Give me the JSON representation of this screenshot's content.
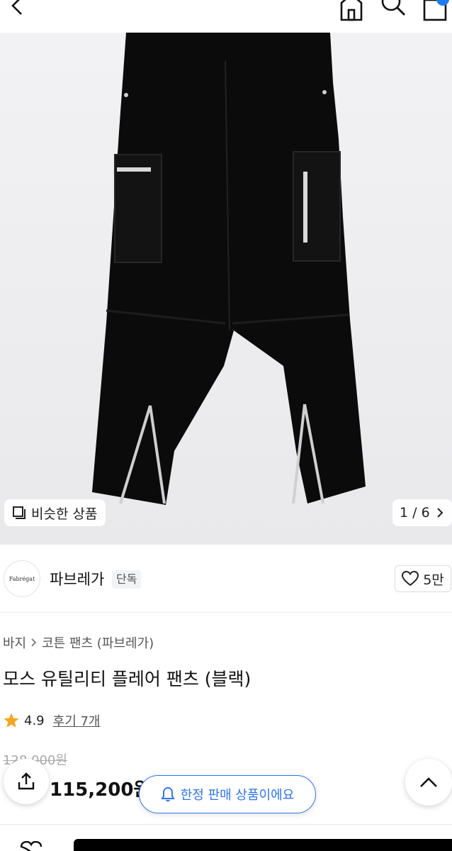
{
  "header": {
    "back_icon": "chevron-left-icon",
    "home_icon": "home-icon",
    "search_icon": "search-icon",
    "cart_icon": "bag-icon",
    "accent": "#1e7cf2"
  },
  "gallery": {
    "similar_label": "비슷한 상품",
    "page_indicator": "1 / 6"
  },
  "brand": {
    "logo_text": "Fabrégat",
    "name": "파브레가",
    "tag": "단독",
    "like_count": "5만"
  },
  "breadcrumb": {
    "level1": "바지",
    "level2": "코튼 팬츠 (파브레가)"
  },
  "product": {
    "title": "모스 유틸리티 플레어 팬츠 (블랙)",
    "rating": "4.9",
    "reviews_label": "후기 7개",
    "original_price": "128,000원",
    "sale_price": "115,200원"
  },
  "floating": {
    "limited_label": "한정 판매 상품이에요",
    "accent": "#2f74ef"
  }
}
